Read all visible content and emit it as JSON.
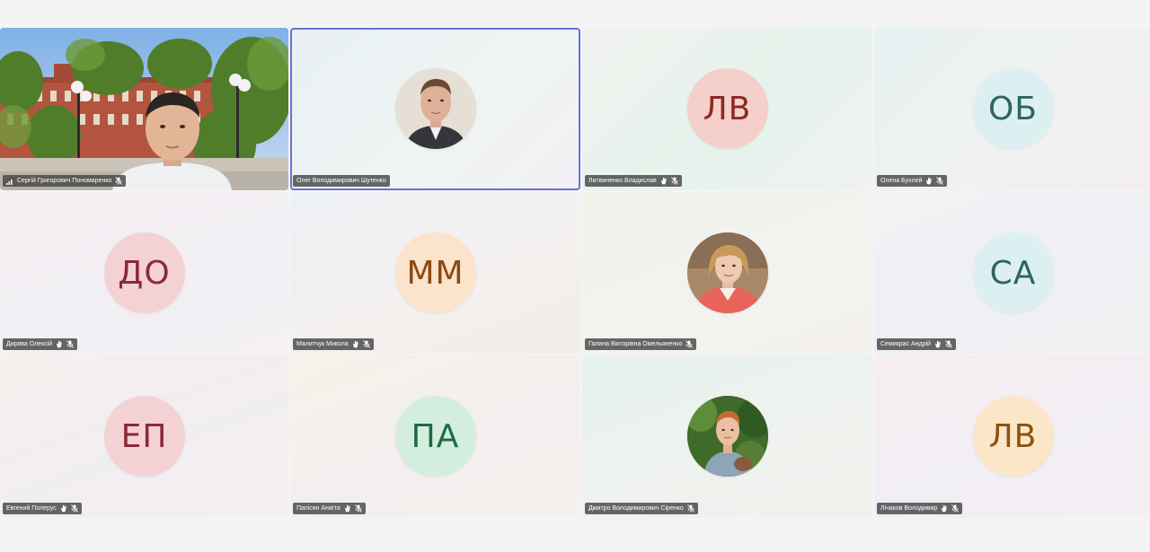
{
  "meeting": {
    "participants": [
      {
        "name": "Сергій Григорович Пономаренко",
        "type": "video",
        "icons": [
          "signal-icon",
          "mic-off-icon"
        ]
      },
      {
        "name": "Олег Володимирович Шутенко",
        "type": "photo",
        "icons": [],
        "active": true
      },
      {
        "name": "Литвиненко Владислав",
        "type": "initials",
        "initials": "ЛВ",
        "avatar_bg": "#f5cfc9",
        "avatar_fg": "#8b2a20",
        "icons": [
          "raised-hand-icon",
          "mic-off-icon"
        ]
      },
      {
        "name": "Олена Бухлей",
        "type": "initials",
        "initials": "ОБ",
        "avatar_bg": "#dcf0f2",
        "avatar_fg": "#2e6464",
        "icons": [
          "raised-hand-icon",
          "mic-off-icon"
        ]
      },
      {
        "name": "Дирява Олексій",
        "type": "initials",
        "initials": "ДО",
        "avatar_bg": "#f4d2d4",
        "avatar_fg": "#8a2a36",
        "icons": [
          "raised-hand-icon",
          "mic-off-icon"
        ]
      },
      {
        "name": "Малитчук Микола",
        "type": "initials",
        "initials": "ММ",
        "avatar_bg": "#fbe3cc",
        "avatar_fg": "#8a4a14",
        "icons": [
          "raised-hand-icon",
          "mic-off-icon"
        ]
      },
      {
        "name": "Галина Вікторівна Омельяненко",
        "type": "photo",
        "icons": [
          "mic-off-icon"
        ]
      },
      {
        "name": "Семикрас Андрій",
        "type": "initials",
        "initials": "СА",
        "avatar_bg": "#dcf0f2",
        "avatar_fg": "#2e6464",
        "icons": [
          "raised-hand-icon",
          "mic-off-icon"
        ]
      },
      {
        "name": "Евгений Полерус",
        "type": "initials",
        "initials": "ЕП",
        "avatar_bg": "#f4d2d4",
        "avatar_fg": "#8a2a36",
        "icons": [
          "raised-hand-icon",
          "mic-off-icon"
        ]
      },
      {
        "name": "Папісян Анаїта",
        "type": "initials",
        "initials": "ПА",
        "avatar_bg": "#d3eede",
        "avatar_fg": "#1f6a44",
        "icons": [
          "raised-hand-icon",
          "mic-off-icon"
        ]
      },
      {
        "name": "Дмитро Володимирович Сіренко",
        "type": "photo",
        "icons": [
          "mic-off-icon"
        ]
      },
      {
        "name": "Лічаков Володимир",
        "type": "initials",
        "initials": "ЛВ",
        "avatar_bg": "#fbe6c8",
        "avatar_fg": "#8a5410",
        "icons": [
          "raised-hand-icon",
          "mic-off-icon"
        ]
      }
    ]
  }
}
